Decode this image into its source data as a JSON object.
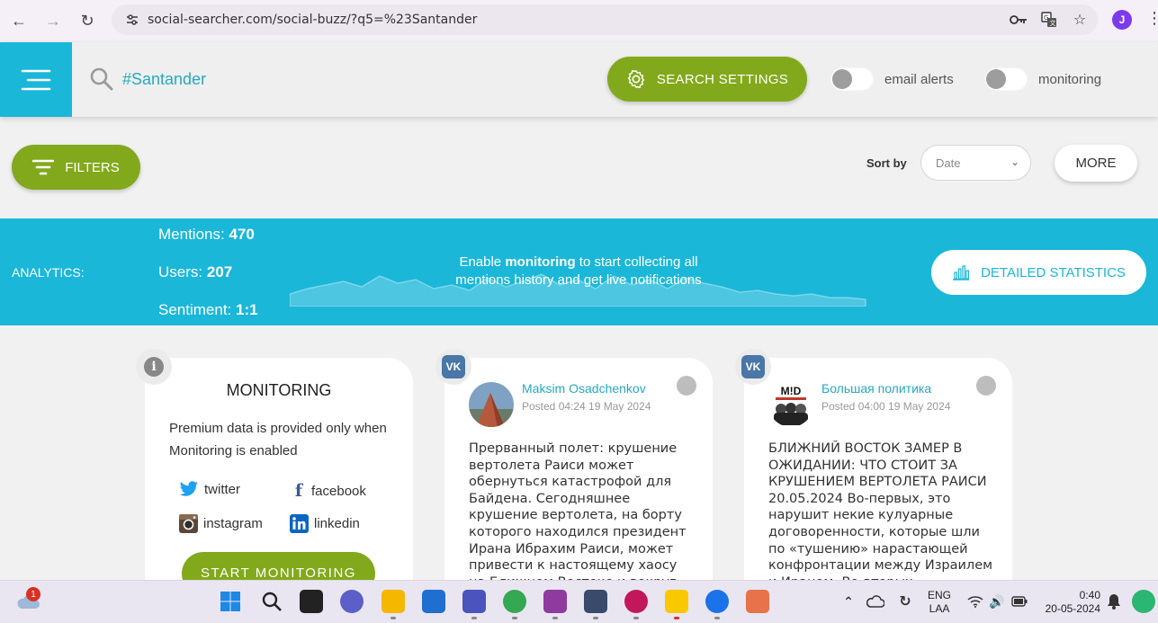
{
  "browser": {
    "url": "social-searcher.com/social-buzz/?q5=%23Santander",
    "profile_initial": "J"
  },
  "header": {
    "search_query": "#Santander",
    "settings_label": "SEARCH SETTINGS",
    "email_alerts_label": "email alerts",
    "monitoring_label": "monitoring",
    "email_alerts_on": false,
    "monitoring_on": false
  },
  "toolbar": {
    "filters_label": "FILTERS",
    "sort_by_label": "Sort by",
    "sort_value": "Date",
    "more_label": "MORE"
  },
  "analytics": {
    "label": "ANALYTICS:",
    "mentions_label": "Mentions:",
    "mentions_value": "470",
    "users_label": "Users:",
    "users_value": "207",
    "sentiment_label": "Sentiment:",
    "sentiment_value": "1:1",
    "msg_pre": "Enable ",
    "msg_bold": "monitoring",
    "msg_post": " to start collecting all mentions history and get live notifications",
    "detailed_label": "DETAILED STATISTICS"
  },
  "monitoring_card": {
    "title": "MONITORING",
    "description": "Premium data is provided only when Monitoring is enabled",
    "networks": [
      "twitter",
      "facebook",
      "instagram",
      "linkedin"
    ],
    "start_label": "START MONITORING"
  },
  "posts": [
    {
      "network": "VK",
      "author": "Maksim Osadchenkov",
      "time": "Posted 04:24 19 May 2024",
      "text": "Прерванный полет: крушение вертолета Раиси может обернуться катастрофой для Байдена. Сегодняшнее крушение вертолета, на борту которого находился президент Ирана Ибрахим Раиси, может привести к настоящему хаосу на Ближнем Востоке и вокруг"
    },
    {
      "network": "VK",
      "author": "Большая политика",
      "avatar_text": "M!D",
      "time": "Posted 04:00 19 May 2024",
      "text": "БЛИЖНИЙ ВОСТОК ЗАМЕР В ОЖИДАНИИ: ЧТО СТОИТ ЗА КРУШЕНИЕМ ВЕРТОЛЕТА РАИСИ 20.05.2024 Во-первых, это нарушит некие кулуарные договоренности, которые шли по «тушению» нарастающей конфронтации между Израилем и Ираном. Во-вторых"
    }
  ],
  "taskbar": {
    "notification_count": "1",
    "lang_top": "ENG",
    "lang_bottom": "LAA",
    "time": "0:40",
    "date": "20-05-2024"
  }
}
